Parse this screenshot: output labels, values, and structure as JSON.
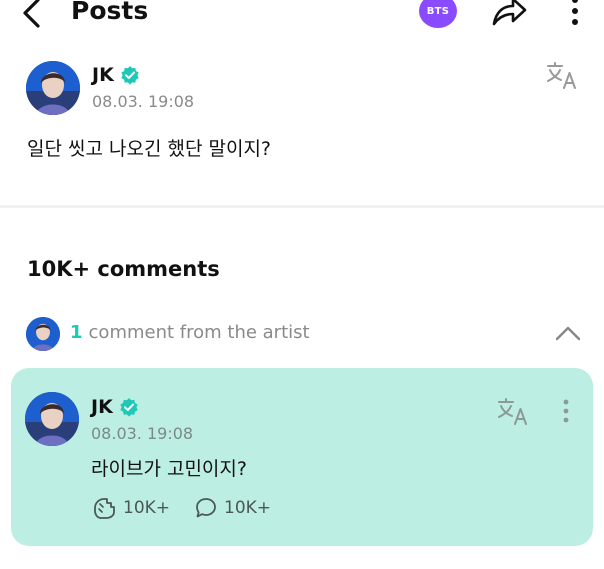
{
  "header": {
    "title": "Posts",
    "community_badge": "BTS",
    "icons": [
      "back-arrow-icon",
      "share-icon",
      "more-vertical-icon"
    ]
  },
  "post": {
    "author": "JK",
    "verified": true,
    "timestamp": "08.03. 19:08",
    "body": "일단 씻고 나오긴 했단 말이지?",
    "icons": [
      "translate-icon"
    ]
  },
  "comments": {
    "count_label": "10K+ comments",
    "artist_section": {
      "count": "1",
      "label": "comment from the artist",
      "expanded": true
    }
  },
  "artist_comment": {
    "author": "JK",
    "verified": true,
    "timestamp": "08.03. 19:08",
    "body": "라이브가 고민이지?",
    "likes": "10K+",
    "replies": "10K+"
  },
  "colors": {
    "accent": "#1ec8b8",
    "badge": "#8a4bff",
    "card_background": "#bdeee3",
    "muted_text": "#8a8a8a"
  }
}
